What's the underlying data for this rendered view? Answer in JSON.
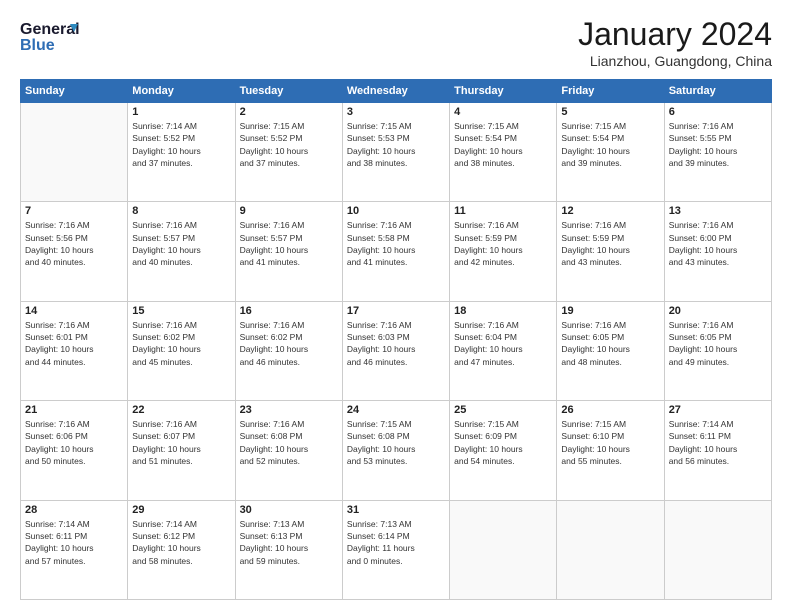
{
  "logo": {
    "line1": "General",
    "line2": "Blue"
  },
  "header": {
    "title": "January 2024",
    "location": "Lianzhou, Guangdong, China"
  },
  "weekdays": [
    "Sunday",
    "Monday",
    "Tuesday",
    "Wednesday",
    "Thursday",
    "Friday",
    "Saturday"
  ],
  "weeks": [
    [
      {
        "num": "",
        "info": ""
      },
      {
        "num": "1",
        "info": "Sunrise: 7:14 AM\nSunset: 5:52 PM\nDaylight: 10 hours\nand 37 minutes."
      },
      {
        "num": "2",
        "info": "Sunrise: 7:15 AM\nSunset: 5:52 PM\nDaylight: 10 hours\nand 37 minutes."
      },
      {
        "num": "3",
        "info": "Sunrise: 7:15 AM\nSunset: 5:53 PM\nDaylight: 10 hours\nand 38 minutes."
      },
      {
        "num": "4",
        "info": "Sunrise: 7:15 AM\nSunset: 5:54 PM\nDaylight: 10 hours\nand 38 minutes."
      },
      {
        "num": "5",
        "info": "Sunrise: 7:15 AM\nSunset: 5:54 PM\nDaylight: 10 hours\nand 39 minutes."
      },
      {
        "num": "6",
        "info": "Sunrise: 7:16 AM\nSunset: 5:55 PM\nDaylight: 10 hours\nand 39 minutes."
      }
    ],
    [
      {
        "num": "7",
        "info": "Sunrise: 7:16 AM\nSunset: 5:56 PM\nDaylight: 10 hours\nand 40 minutes."
      },
      {
        "num": "8",
        "info": "Sunrise: 7:16 AM\nSunset: 5:57 PM\nDaylight: 10 hours\nand 40 minutes."
      },
      {
        "num": "9",
        "info": "Sunrise: 7:16 AM\nSunset: 5:57 PM\nDaylight: 10 hours\nand 41 minutes."
      },
      {
        "num": "10",
        "info": "Sunrise: 7:16 AM\nSunset: 5:58 PM\nDaylight: 10 hours\nand 41 minutes."
      },
      {
        "num": "11",
        "info": "Sunrise: 7:16 AM\nSunset: 5:59 PM\nDaylight: 10 hours\nand 42 minutes."
      },
      {
        "num": "12",
        "info": "Sunrise: 7:16 AM\nSunset: 5:59 PM\nDaylight: 10 hours\nand 43 minutes."
      },
      {
        "num": "13",
        "info": "Sunrise: 7:16 AM\nSunset: 6:00 PM\nDaylight: 10 hours\nand 43 minutes."
      }
    ],
    [
      {
        "num": "14",
        "info": "Sunrise: 7:16 AM\nSunset: 6:01 PM\nDaylight: 10 hours\nand 44 minutes."
      },
      {
        "num": "15",
        "info": "Sunrise: 7:16 AM\nSunset: 6:02 PM\nDaylight: 10 hours\nand 45 minutes."
      },
      {
        "num": "16",
        "info": "Sunrise: 7:16 AM\nSunset: 6:02 PM\nDaylight: 10 hours\nand 46 minutes."
      },
      {
        "num": "17",
        "info": "Sunrise: 7:16 AM\nSunset: 6:03 PM\nDaylight: 10 hours\nand 46 minutes."
      },
      {
        "num": "18",
        "info": "Sunrise: 7:16 AM\nSunset: 6:04 PM\nDaylight: 10 hours\nand 47 minutes."
      },
      {
        "num": "19",
        "info": "Sunrise: 7:16 AM\nSunset: 6:05 PM\nDaylight: 10 hours\nand 48 minutes."
      },
      {
        "num": "20",
        "info": "Sunrise: 7:16 AM\nSunset: 6:05 PM\nDaylight: 10 hours\nand 49 minutes."
      }
    ],
    [
      {
        "num": "21",
        "info": "Sunrise: 7:16 AM\nSunset: 6:06 PM\nDaylight: 10 hours\nand 50 minutes."
      },
      {
        "num": "22",
        "info": "Sunrise: 7:16 AM\nSunset: 6:07 PM\nDaylight: 10 hours\nand 51 minutes."
      },
      {
        "num": "23",
        "info": "Sunrise: 7:16 AM\nSunset: 6:08 PM\nDaylight: 10 hours\nand 52 minutes."
      },
      {
        "num": "24",
        "info": "Sunrise: 7:15 AM\nSunset: 6:08 PM\nDaylight: 10 hours\nand 53 minutes."
      },
      {
        "num": "25",
        "info": "Sunrise: 7:15 AM\nSunset: 6:09 PM\nDaylight: 10 hours\nand 54 minutes."
      },
      {
        "num": "26",
        "info": "Sunrise: 7:15 AM\nSunset: 6:10 PM\nDaylight: 10 hours\nand 55 minutes."
      },
      {
        "num": "27",
        "info": "Sunrise: 7:14 AM\nSunset: 6:11 PM\nDaylight: 10 hours\nand 56 minutes."
      }
    ],
    [
      {
        "num": "28",
        "info": "Sunrise: 7:14 AM\nSunset: 6:11 PM\nDaylight: 10 hours\nand 57 minutes."
      },
      {
        "num": "29",
        "info": "Sunrise: 7:14 AM\nSunset: 6:12 PM\nDaylight: 10 hours\nand 58 minutes."
      },
      {
        "num": "30",
        "info": "Sunrise: 7:13 AM\nSunset: 6:13 PM\nDaylight: 10 hours\nand 59 minutes."
      },
      {
        "num": "31",
        "info": "Sunrise: 7:13 AM\nSunset: 6:14 PM\nDaylight: 11 hours\nand 0 minutes."
      },
      {
        "num": "",
        "info": ""
      },
      {
        "num": "",
        "info": ""
      },
      {
        "num": "",
        "info": ""
      }
    ]
  ]
}
